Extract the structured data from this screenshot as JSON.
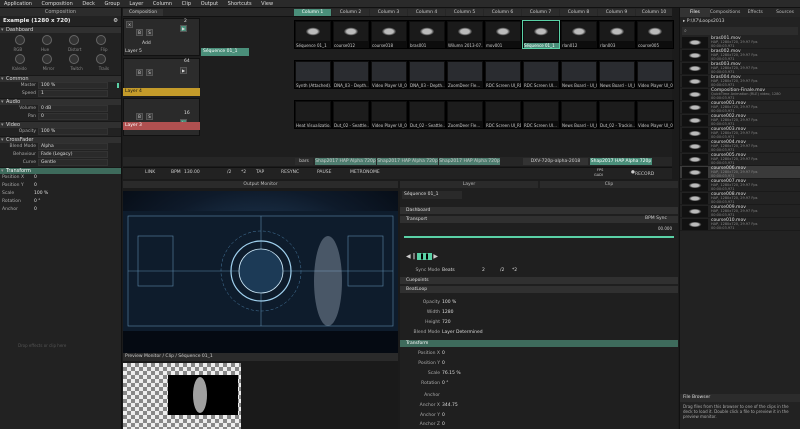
{
  "menubar": {
    "items": [
      "Application",
      "Composition",
      "Deck",
      "Group",
      "Layer",
      "Column",
      "Clip",
      "Output",
      "Shortcuts",
      "View"
    ]
  },
  "left": {
    "tab": "Composition",
    "comp_title": "Example (1280 x 720)",
    "dashboard_label": "Dashboard",
    "knob_labels": [
      "RGB",
      "Hue",
      "Distort",
      "Flip"
    ],
    "knob_labels2": [
      "Kaleido",
      "Mirror",
      "Twitch",
      "Trails"
    ],
    "sections": {
      "common": "Common",
      "audio": "Audio",
      "video": "Video",
      "crossfader": "CrossFader",
      "transform": "Transform",
      "anchor": "Anchor"
    },
    "master_label": "Master",
    "master_value": "100 %",
    "speed_label": "Speed",
    "speed_value": "1",
    "volume_label": "Volume",
    "volume_value": "0 dB",
    "pan_label": "Pan",
    "pan_value": "0",
    "opacity_label": "Opacity",
    "opacity_value": "100 %",
    "blend_label": "Blend Mode",
    "blend_value": "Alpha",
    "behaviour_label": "Behaviour",
    "behaviour_value": "Fade (Legacy)",
    "curve_label": "Curve",
    "curve_value": "Gentle",
    "posx_label": "Position X",
    "posx_value": "0",
    "posy_label": "Position Y",
    "posy_value": "0",
    "scale_label": "Scale",
    "scale_value": "100 %",
    "rotation_label": "Rotation",
    "rotation_value": "0 °",
    "anchor_value": "0",
    "hint": "Drop effects or clip here"
  },
  "deck": {
    "tab_composition": "Composition",
    "columns": [
      "Column 1",
      "Column 2",
      "Column 3",
      "Column 4",
      "Column 5",
      "Column 6",
      "Column 7",
      "Column 8",
      "Column 9",
      "Column 10"
    ],
    "layers": [
      {
        "name": "Layer 5",
        "clip_label": "Séquence 01_1",
        "num": "2",
        "clips": [
          "Séquence 01_1",
          "course012",
          "course018",
          "bras001",
          "Wilumn 2013-07...",
          "mov001",
          "Séquence 01_1",
          "rlan012",
          "rlan003",
          "course005"
        ]
      },
      {
        "name": "Layer 4",
        "clip_label": "",
        "num": "64",
        "clips": [
          "Synth (Attached)...",
          "DNA_03 - Depth...",
          "Video Player UI_03...",
          "DNA_03 - Depth...",
          "ZoomDeer Fle...",
          "RDC Screen UI_RDC...",
          "RDC Screen UI...",
          "News Board - UI_06...",
          "News Board - UI_06...",
          "Video Player UI_06..."
        ]
      },
      {
        "name": "Layer 3",
        "clip_label": "",
        "num": "16",
        "clips": [
          "Heat Visualizatio...",
          "Dut_02 - Seattle...",
          "Video Player UI_03...",
          "Dut_02 - Seattle...",
          "ZoomDeer Fle...",
          "RDC Screen UI_RDC...",
          "RDC Screen UI...",
          "News Board - UI_06...",
          "Dut_02 - Trackin...",
          "Video Player UI_06..."
        ]
      }
    ],
    "btns": [
      "B",
      "S",
      "Add"
    ],
    "lower_tabs": [
      "bars",
      "Shap2017 HAP Alpha 720p",
      "Shap2017 HAP Alpha 720p",
      "Shap2017 HAP Alpha 720p",
      "DXV-720p-alpha-2018",
      "Shap2017 HAP Alpha 720p"
    ]
  },
  "transport": {
    "link": "LINK",
    "bpm_label": "BPM",
    "bpm": "130.00",
    "half": "/2",
    "double": "*2",
    "tap": "TAP",
    "resync": "RESYNC",
    "pause": "PAUSE",
    "metronome": "METRONOME",
    "fps": "FPS",
    "gadi": "GADI",
    "record": "RECORD"
  },
  "output_monitor": {
    "title": "Output Monitor"
  },
  "preview_monitor": {
    "title": "Preview Monitor / Clip / Séquence 01_1"
  },
  "layer_panel": {
    "tab_layer": "Layer",
    "tab_clip": "Clip",
    "clip_name": "Séquence 01_1",
    "dashboard": "Dashboard",
    "transport": "Transport",
    "bpm_sync": "BPM Sync",
    "time_value": "00.000",
    "sync_mode_label": "Sync Mode",
    "sync_mode_value": "Beats",
    "sync_num": "2",
    "sync_half": "/2",
    "sync_double": "*2",
    "cuepoints": "Cuepoints",
    "beatloop": "BeatLoop",
    "opacity_label": "Opacity",
    "opacity_value": "100 %",
    "width_label": "Width",
    "width_value": "1280",
    "height_label": "Height",
    "height_value": "720",
    "blend_label": "Blend Mode",
    "blend_value": "Layer Determined",
    "transform": "Transform",
    "posx_label": "Position X",
    "posx_value": "0",
    "posy_label": "Position Y",
    "posy_value": "0",
    "scale_label": "Scale",
    "scale_value": "76.15 %",
    "rotation_label": "Rotation",
    "rotation_value": "0 °",
    "anchor": "Anchor",
    "ax_label": "Anchor X",
    "ax_value": "344.75",
    "ay_label": "Anchor Y",
    "ay_value": "0",
    "az_label": "Anchor Z",
    "az_value": "0"
  },
  "right": {
    "tabs": [
      "Files",
      "Compositions",
      "Effects",
      "Sources"
    ],
    "path": "P:\\X7\\Loops2013",
    "files": [
      {
        "name": "bras001.mov",
        "det": "HAP, 1280x720, 29.97 Fps\n00:00:03.971"
      },
      {
        "name": "bras002.mov",
        "det": "HAP, 1280x720, 29.97 Fps\n00:00:03.971"
      },
      {
        "name": "bras003.mov",
        "det": "HAP, 1280x720, 29.97 Fps\n00:00:03.971"
      },
      {
        "name": "bras004.mov",
        "det": "HAP, 1280x720, 29.97 Fps\n00:00:03.971"
      },
      {
        "name": "Composition-Finale.mov",
        "det": "QuickTime Animation (RLE) video, 1280\n00:00:03.971"
      },
      {
        "name": "course001.mov",
        "det": "HAP, 1280x720, 29.97 Fps\n00:00:03.971"
      },
      {
        "name": "course002.mov",
        "det": "HAP, 1280x720, 29.97 Fps\n00:00:03.971"
      },
      {
        "name": "course003.mov",
        "det": "HAP, 1280x720, 29.97 Fps\n00:00:03.971"
      },
      {
        "name": "course004.mov",
        "det": "HAP, 1280x720, 29.97 Fps\n00:00:03.971"
      },
      {
        "name": "course005.mov",
        "det": "HAP, 1280x720, 29.97 Fps\n00:00:03.971"
      },
      {
        "name": "course006.mov",
        "det": "HAP, 1280x720, 29.97 Fps\n00:00:03.971"
      },
      {
        "name": "course007.mov",
        "det": "HAP, 1280x720, 29.97 Fps\n00:00:03.971"
      },
      {
        "name": "course008.mov",
        "det": "HAP, 1280x720, 29.97 Fps\n00:00:03.971"
      },
      {
        "name": "course009.mov",
        "det": "HAP, 1280x720, 29.97 Fps\n00:00:03.971"
      },
      {
        "name": "course010.mov",
        "det": "HAP, 1280x720, 29.97 Fps\n00:00:03.971"
      }
    ],
    "browser_title": "File Browser",
    "browser_help": "Drag files from this browser to one of the clips in the deck to load it. Double click a file to preview it in the preview monitor."
  },
  "colors": {
    "accent": "#5ad1a6",
    "section_active": "#3e6b5c"
  }
}
